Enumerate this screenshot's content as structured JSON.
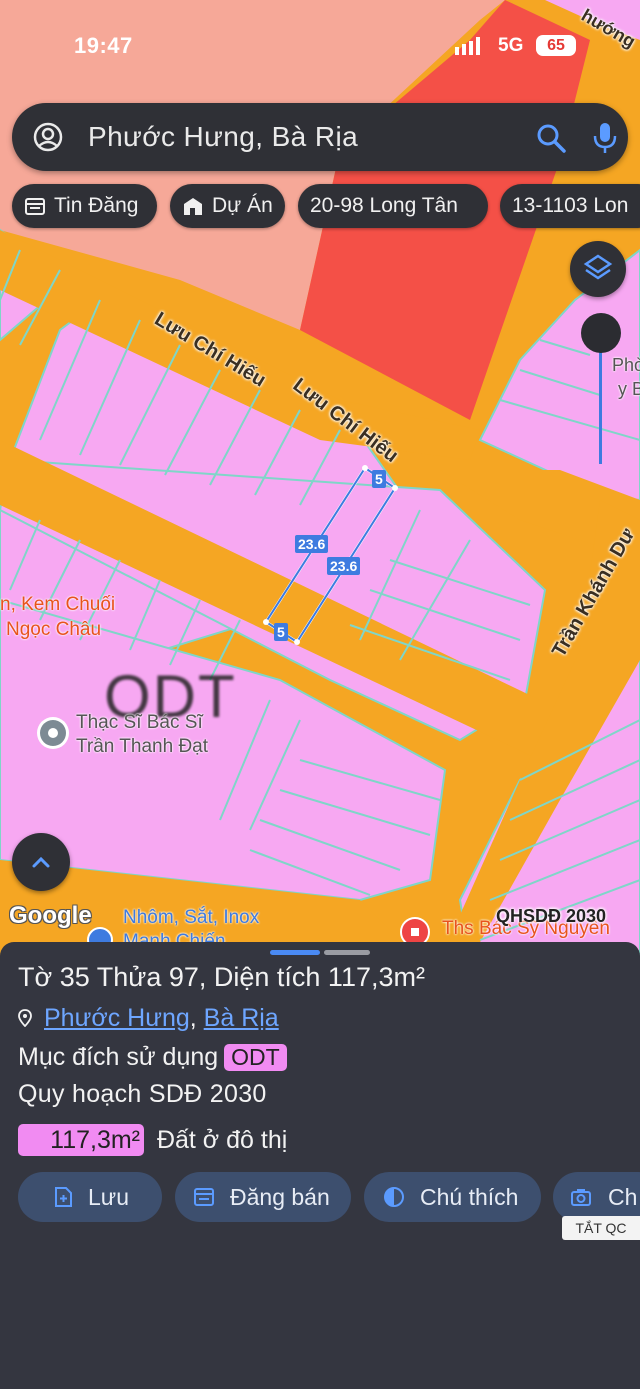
{
  "status_bar": {
    "time": "19:47",
    "network": "5G",
    "battery": "65"
  },
  "search": {
    "query": "Phước Hưng, Bà Rịa"
  },
  "chips": [
    {
      "label": "Tin Đăng",
      "icon": "listing-icon"
    },
    {
      "label": "Dự Án",
      "icon": "building-icon"
    },
    {
      "label": "20-98 Long Tân"
    },
    {
      "label": "13-1103 Lon"
    }
  ],
  "map": {
    "roads": [
      "Lưu Chí Hiếu",
      "Lưu Chí Hiếu",
      "Trần Khánh Dư",
      "hướng"
    ],
    "pois": [
      {
        "line1": "n, Kem Chuối",
        "line2": "Ngọc Châu"
      },
      {
        "line1": "Thạc Sĩ Bác Sĩ",
        "line2": "Trần Thanh Đạt"
      },
      {
        "line1": "Nhôm, Sắt, Inox",
        "line2": "Mạnh Chiến"
      },
      {
        "line1": "Ths Bác Sỹ Nguyễn"
      },
      {
        "line1": "Phò",
        "line2": "y B"
      }
    ],
    "zone_label": "ODT",
    "dimensions": [
      "5",
      "23.6",
      "23.6",
      "5"
    ],
    "google_logo": "Google",
    "plan_label": "QHSDĐ 2030",
    "colors": {
      "residential": "#f7a8f2",
      "road": "#f5a623",
      "commercial": "#f45047",
      "salmon": "#f6a898",
      "plot_border": "#7fd6c8"
    }
  },
  "parcel": {
    "title": "Tờ 35 Thửa 97, Diện tích 117,3m²",
    "ward": "Phước Hưng",
    "separator": ",",
    "city": "Bà Rịa",
    "purpose_label": "Mục đích sử dụng",
    "purpose_code": "ODT",
    "plan": "Quy hoạch SDĐ 2030",
    "area_value": "117,3m²",
    "area_type": "Đất ở đô thị"
  },
  "actions": [
    {
      "label": "Lưu",
      "icon": "save-icon"
    },
    {
      "label": "Đăng bán",
      "icon": "post-sale-icon"
    },
    {
      "label": "Chú thích",
      "icon": "legend-icon"
    },
    {
      "label": "Ch",
      "icon": "camera-icon"
    }
  ],
  "ad_badge": "TẮT QC"
}
